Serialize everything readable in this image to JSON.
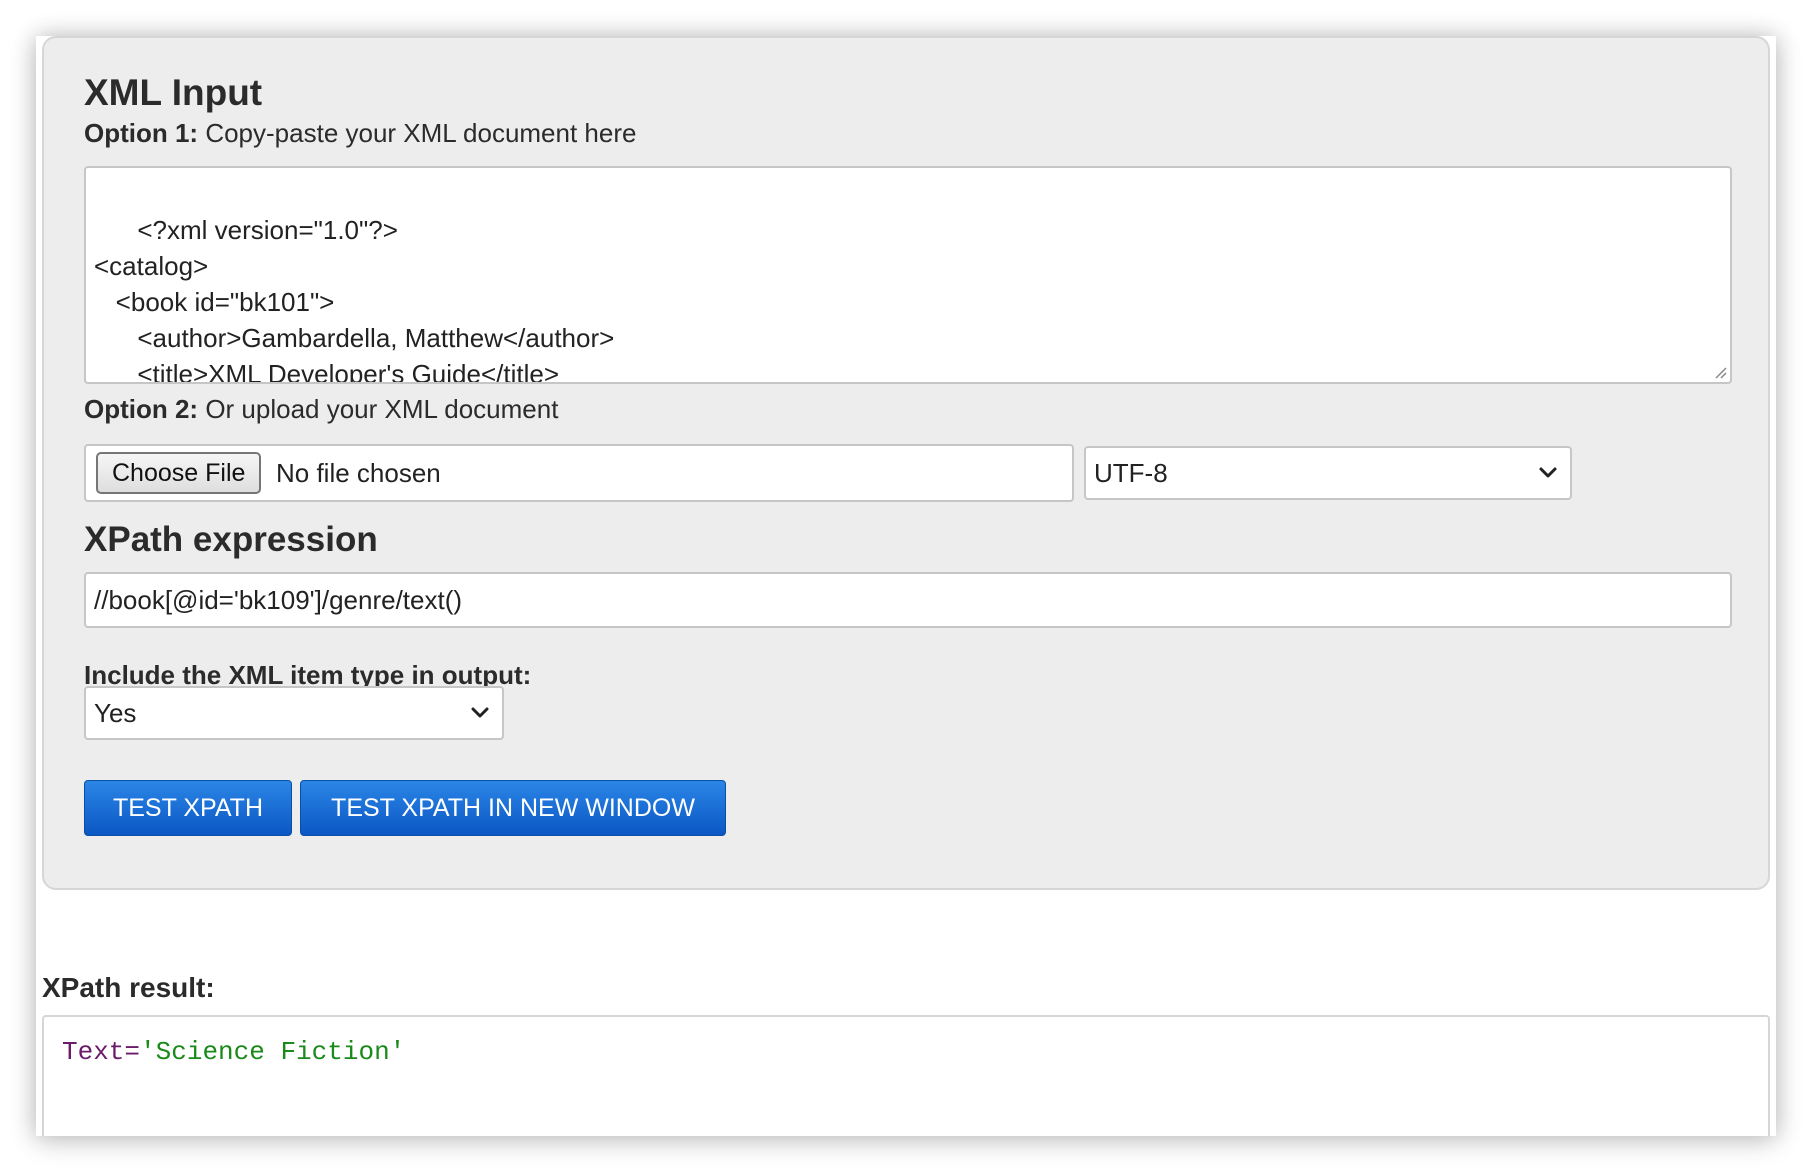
{
  "xml_input": {
    "heading": "XML Input",
    "option1_bold": "Option 1:",
    "option1_text": " Copy-paste your XML document here",
    "textarea_value": "<?xml version=\"1.0\"?>\n<catalog>\n   <book id=\"bk101\">\n      <author>Gambardella, Matthew</author>\n      <title>XML Developer's Guide</title>\n      <genre>Computer</genre>",
    "option2_bold": "Option 2:",
    "option2_text": " Or upload your XML document",
    "choose_file_label": "Choose File",
    "no_file_text": "No file chosen",
    "encoding_selected": "UTF-8"
  },
  "xpath": {
    "heading": "XPath expression",
    "expression": "//book[@id='bk109']/genre/text()",
    "include_type_label": "Include the XML item type in output:",
    "include_type_selected": "Yes"
  },
  "buttons": {
    "test_xpath": "TEST XPATH",
    "test_xpath_new_window": "TEST XPATH IN NEW WINDOW"
  },
  "result": {
    "label": "XPath result:",
    "key": "Text",
    "eq": "=",
    "value": "'Science Fiction'"
  },
  "colors": {
    "button_blue": "#0b57c4",
    "result_key": "#6a1b6a",
    "result_value": "#1a8a1a"
  },
  "icons": {
    "select_arrow": "chevron-down-icon",
    "textarea_resize": "resize-grip-icon"
  }
}
